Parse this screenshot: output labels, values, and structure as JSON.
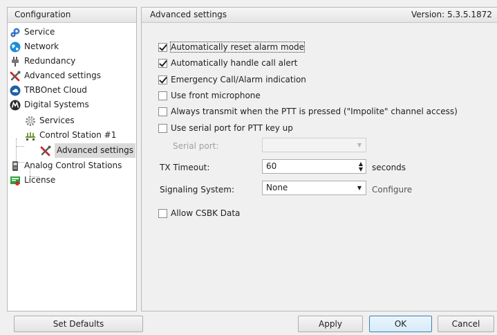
{
  "left_panel": {
    "header": "Configuration",
    "items": [
      {
        "label": "Service",
        "icon": "gears-icon"
      },
      {
        "label": "Network",
        "icon": "globe-icon"
      },
      {
        "label": "Redundancy",
        "icon": "plug-icon"
      },
      {
        "label": "Advanced settings",
        "icon": "tools-icon"
      },
      {
        "label": "TRBOnet Cloud",
        "icon": "cloud-icon"
      },
      {
        "label": "Digital Systems",
        "icon": "motorola-icon"
      },
      {
        "label": "Services",
        "icon": "gear-icon"
      },
      {
        "label": "Control Station #1",
        "icon": "network-icon"
      },
      {
        "label": "Advanced settings",
        "icon": "tools-icon"
      },
      {
        "label": "Analog Control Stations",
        "icon": "radio-icon"
      },
      {
        "label": "License",
        "icon": "license-icon"
      }
    ]
  },
  "right_panel": {
    "title": "Advanced settings",
    "version": "Version: 5.3.5.1872",
    "checkboxes": [
      {
        "label": "Automatically reset alarm mode",
        "checked": true
      },
      {
        "label": "Automatically handle call alert",
        "checked": true
      },
      {
        "label": "Emergency Call/Alarm indication",
        "checked": true
      },
      {
        "label": "Use front microphone",
        "checked": false
      },
      {
        "label": "Always transmit when the PTT is pressed (\"Impolite\" channel access)",
        "checked": false
      },
      {
        "label": "Use serial port for PTT key up",
        "checked": false
      }
    ],
    "serial_port_label": "Serial port:",
    "serial_port_value": "",
    "tx_timeout_label": "TX Timeout:",
    "tx_timeout_value": "60",
    "tx_timeout_unit": "seconds",
    "signaling_label": "Signaling System:",
    "signaling_value": "None",
    "configure_label": "Configure",
    "allow_csbk": {
      "label": "Allow CSBK Data",
      "checked": false
    }
  },
  "buttons": {
    "set_defaults": "Set Defaults",
    "apply": "Apply",
    "ok": "OK",
    "cancel": "Cancel"
  }
}
